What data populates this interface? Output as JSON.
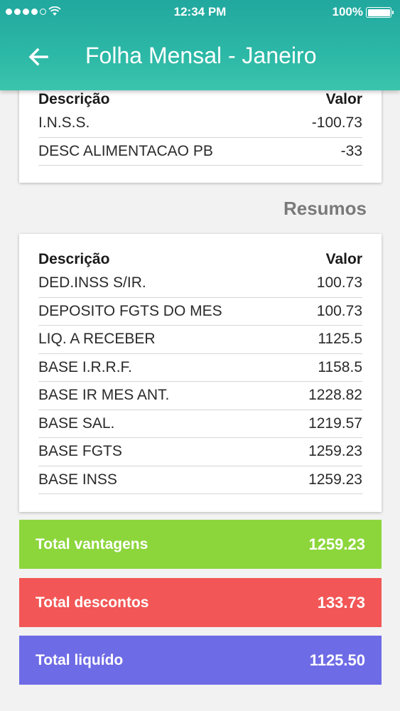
{
  "status_bar": {
    "time": "12:34 PM",
    "battery": "100%"
  },
  "header": {
    "title": "Folha Mensal - Janeiro"
  },
  "descontos_table": {
    "col_desc": "Descrição",
    "col_valor": "Valor",
    "rows": [
      {
        "desc": "I.N.S.S.",
        "valor": "-100.73"
      },
      {
        "desc": "DESC ALIMENTACAO PB",
        "valor": "-33"
      }
    ]
  },
  "resumos": {
    "section_title": "Resumos",
    "col_desc": "Descrição",
    "col_valor": "Valor",
    "rows": [
      {
        "desc": "DED.INSS S/IR.",
        "valor": "100.73"
      },
      {
        "desc": "DEPOSITO FGTS DO MES",
        "valor": "100.73"
      },
      {
        "desc": "LIQ. A RECEBER",
        "valor": "1125.5"
      },
      {
        "desc": "BASE I.R.R.F.",
        "valor": "1158.5"
      },
      {
        "desc": "BASE IR MES ANT.",
        "valor": "1228.82"
      },
      {
        "desc": "BASE SAL.",
        "valor": "1219.57"
      },
      {
        "desc": "BASE FGTS",
        "valor": "1259.23"
      },
      {
        "desc": "BASE INSS",
        "valor": "1259.23"
      }
    ]
  },
  "totals": {
    "vantagens": {
      "label": "Total vantagens",
      "value": "1259.23",
      "color": "#8cd63c"
    },
    "descontos": {
      "label": "Total descontos",
      "value": "133.73",
      "color": "#f25656"
    },
    "liquido": {
      "label": "Total liquído",
      "value": "1125.50",
      "color": "#6e6be6"
    }
  },
  "colors": {
    "header": "#2cb8a6"
  },
  "icons": {
    "back": "arrow-left-icon",
    "wifi": "wifi-icon",
    "battery": "battery-icon",
    "signal": "signal-icon"
  }
}
